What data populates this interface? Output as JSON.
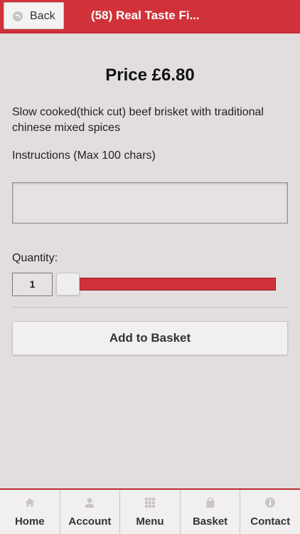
{
  "header": {
    "back_label": "Back",
    "title": "(58) Real Taste Fi..."
  },
  "product": {
    "price": "Price £6.80",
    "description": "Slow cooked(thick cut) beef brisket with traditional chinese mixed spices"
  },
  "instructions": {
    "label": "Instructions (Max 100 chars)",
    "value": "",
    "placeholder": ""
  },
  "quantity": {
    "label": "Quantity:",
    "value": "1"
  },
  "add_button_label": "Add to Basket",
  "footer_nav": [
    {
      "label": "Home",
      "icon": "home-icon"
    },
    {
      "label": "Account",
      "icon": "user-icon"
    },
    {
      "label": "Menu",
      "icon": "grid-icon"
    },
    {
      "label": "Basket",
      "icon": "bag-icon"
    },
    {
      "label": "Contact",
      "icon": "info-icon"
    }
  ],
  "colors": {
    "accent": "#d13239",
    "background": "#e2dedd",
    "button": "#f1efef"
  }
}
